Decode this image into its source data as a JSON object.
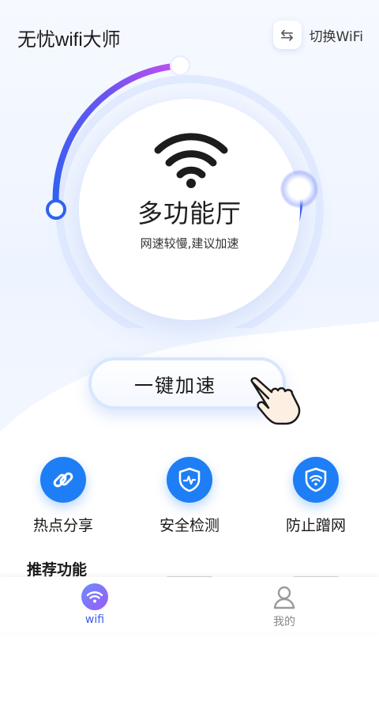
{
  "header": {
    "title": "无忧wifi大师",
    "switch_label": "切换WiFi"
  },
  "dial": {
    "title": "多功能厅",
    "subtitle": "网速较慢,建议加速"
  },
  "boost": {
    "label": "一键加速"
  },
  "features": [
    {
      "label": "热点分享",
      "icon": "link-icon"
    },
    {
      "label": "安全检测",
      "icon": "shield-pulse-icon"
    },
    {
      "label": "防止蹭网",
      "icon": "shield-wifi-icon"
    }
  ],
  "recommend": {
    "title": "推荐功能"
  },
  "nav": [
    {
      "label": "wifi",
      "icon": "wifi-icon",
      "active": true
    },
    {
      "label": "我的",
      "icon": "user-icon",
      "active": false
    }
  ],
  "colors": {
    "primary": "#1e7ef5",
    "arc_start": "#4a6cf7",
    "arc_end": "#c25cf0"
  }
}
